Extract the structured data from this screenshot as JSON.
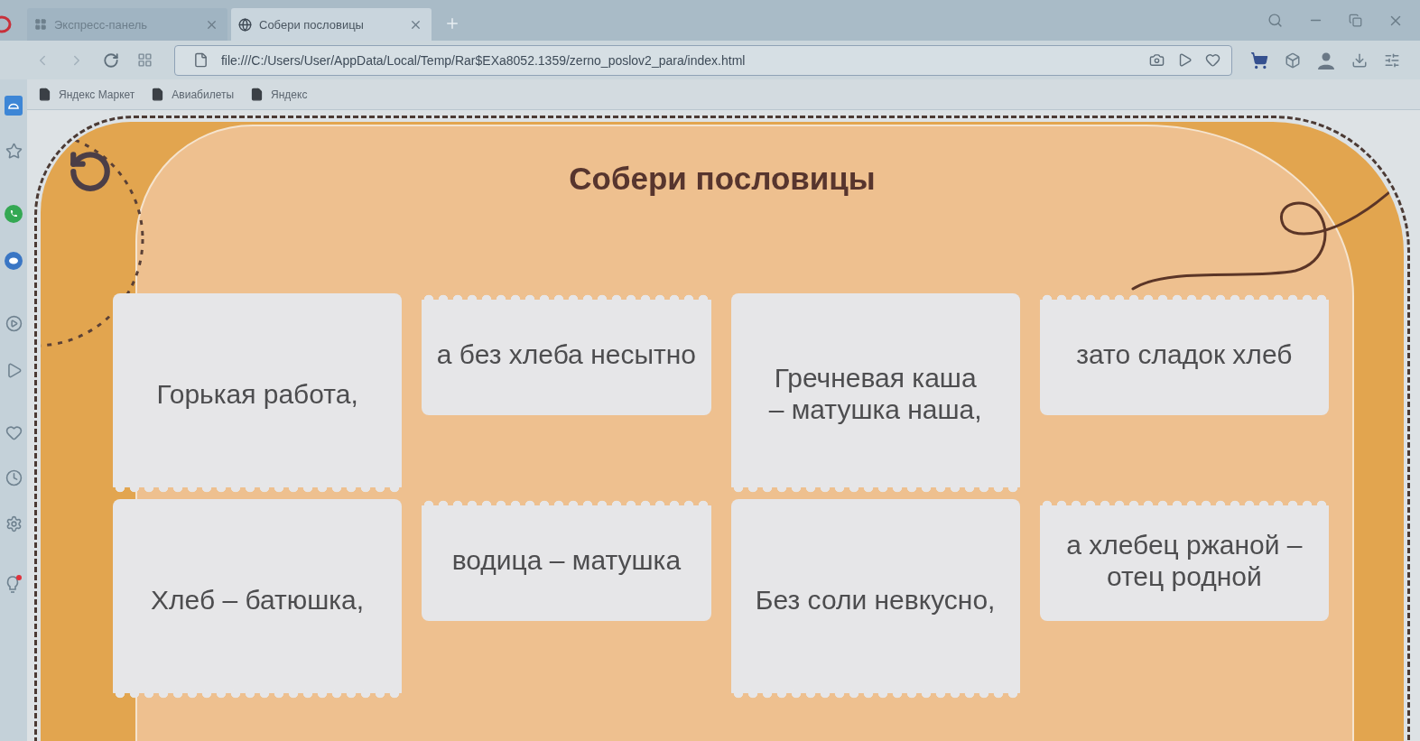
{
  "browser": {
    "tabs": [
      {
        "title": "Экспресс-панель",
        "selected": false,
        "kind": "panel"
      },
      {
        "title": "Собери пословицы",
        "selected": true,
        "kind": "page"
      }
    ],
    "address": "file:///C:/Users/User/AppData/Local/Temp/Rar$EXa8052.1359/zerno_poslov2_para/index.html",
    "bookmarks": [
      "Яндекс Маркет",
      "Авиабилеты",
      "Яндекс"
    ]
  },
  "game": {
    "title": "Собери пословицы",
    "cards": [
      {
        "text": "Горькая работа,",
        "kind": "beginning"
      },
      {
        "text": "а без хлеба несытно",
        "kind": "ending"
      },
      {
        "text": "Гречневая каша\n– матушка наша,",
        "kind": "beginning"
      },
      {
        "text": "зато сладок хлеб",
        "kind": "ending"
      },
      {
        "text": "Хлеб – батюшка,",
        "kind": "beginning"
      },
      {
        "text": "водица – матушка",
        "kind": "ending"
      },
      {
        "text": "Без соли невкусно,",
        "kind": "beginning"
      },
      {
        "text": "а хлебец ржаной –\nотец родной",
        "kind": "ending"
      }
    ]
  }
}
